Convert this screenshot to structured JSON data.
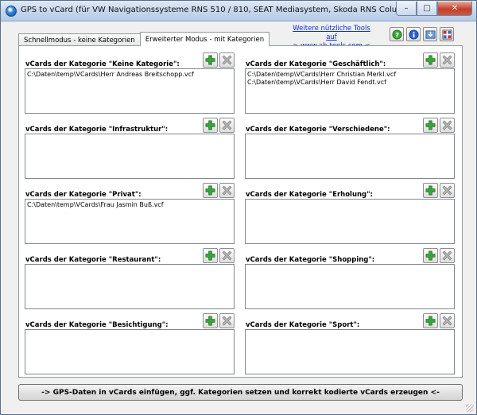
{
  "window": {
    "title": "GPS to vCard (für VW Navigationssysteme RNS 510 / 810, SEAT Mediasystem, Skoda RNS Columbus)",
    "minimize": "–",
    "maximize": "□",
    "close": "✕"
  },
  "tabs": [
    {
      "label": "Schnellmodus - keine Kategorien"
    },
    {
      "label": "Erweiterter Modus - mit Kategorien"
    }
  ],
  "link": {
    "line1": "Weitere nützliche Tools auf",
    "line2": "-> www.ab-tools.com <-"
  },
  "toolbar": {
    "icons": [
      "help-icon",
      "info-icon",
      "download-icon",
      "grid-icon"
    ]
  },
  "categories": [
    {
      "label": "vCards der Kategorie \"Keine Kategorie\":",
      "files": [
        "C:\\Daten\\temp\\VCards\\Herr Andreas Breitschopp.vcf"
      ]
    },
    {
      "label": "vCards der Kategorie \"Geschäftlich\":",
      "files": [
        "C:\\Daten\\temp\\VCards\\Herr Christian Merkl.vcf",
        "C:\\Daten\\temp\\VCards\\Herr David Fendt.vcf"
      ]
    },
    {
      "label": "vCards der Kategorie \"Infrastruktur\":",
      "files": []
    },
    {
      "label": "vCards der Kategorie \"Verschiedene\":",
      "files": []
    },
    {
      "label": "vCards der Kategorie \"Privat\":",
      "files": [
        "C:\\Daten\\temp\\VCards\\Frau Jasmin Buß.vcf"
      ]
    },
    {
      "label": "vCards der Kategorie \"Erholung\":",
      "files": []
    },
    {
      "label": "vCards der Kategorie \"Restaurant\":",
      "files": []
    },
    {
      "label": "vCards der Kategorie \"Shopping\":",
      "files": []
    },
    {
      "label": "vCards der Kategorie \"Besichtigung\":",
      "files": []
    },
    {
      "label": "vCards der Kategorie \"Sport\":",
      "files": []
    }
  ],
  "action": {
    "label": "-> GPS-Daten in vCards einfügen, ggf. Kategorien setzen und korrekt kodierte vCards erzeugen <-"
  },
  "colors": {
    "add": "#3aa43a",
    "remove": "#9a9a9a",
    "link": "#0b2cd6"
  }
}
